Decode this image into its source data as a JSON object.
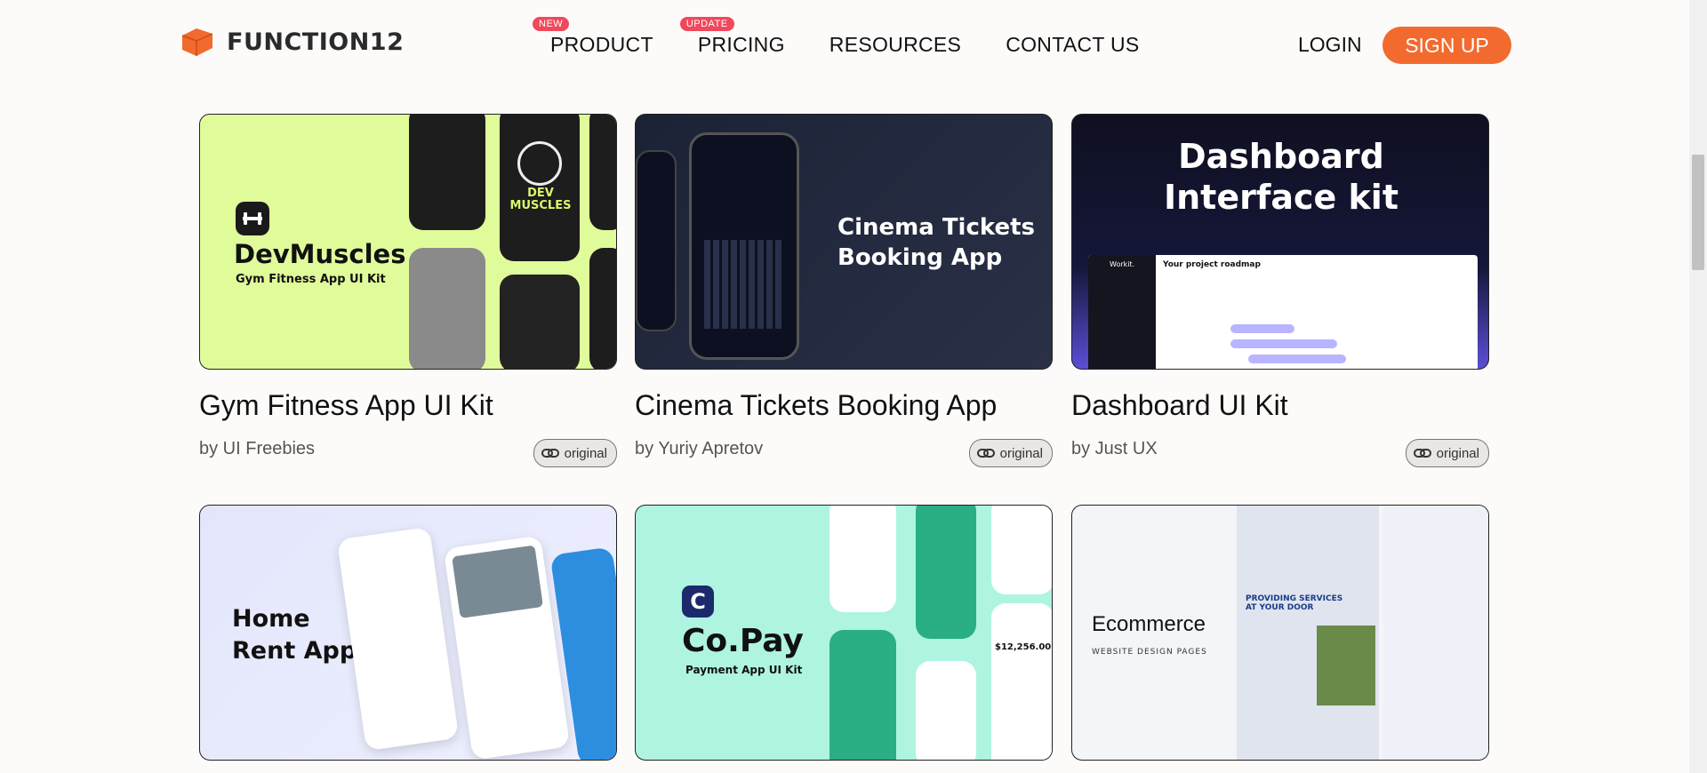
{
  "nav": {
    "logo_text": "FUNCTION12",
    "items": [
      {
        "label": "PRODUCT",
        "badge": "NEW"
      },
      {
        "label": "PRICING",
        "badge": "UPDATE"
      },
      {
        "label": "RESOURCES",
        "badge": ""
      },
      {
        "label": "CONTACT US",
        "badge": ""
      }
    ],
    "login": "LOGIN",
    "signup": "SIGN UP",
    "accent": "#f26a2e",
    "badge_color": "#f0485c"
  },
  "cards": [
    {
      "title": "Gym Fitness App UI Kit",
      "author": "by UI Freebies",
      "tag": "original",
      "thumb": {
        "heading": "DevMuscles",
        "sub": "Gym Fitness App UI Kit",
        "badge": "DEV MUSCLES"
      }
    },
    {
      "title": "Cinema Tickets Booking App",
      "author": "by Yuriy Apretov",
      "tag": "original",
      "thumb": {
        "heading": "Cinema Tickets Booking App"
      }
    },
    {
      "title": "Dashboard UI Kit",
      "author": "by Just UX",
      "tag": "original",
      "thumb": {
        "heading": "Dashboard Interface kit",
        "panel_title": "Your project roadmap",
        "brand": "Workit."
      }
    },
    {
      "title": "",
      "author": "",
      "tag": "",
      "thumb": {
        "heading": "Home Rent App"
      }
    },
    {
      "title": "",
      "author": "",
      "tag": "",
      "thumb": {
        "heading": "Co.Pay",
        "sub": "Payment App UI Kit",
        "amount": "$12,256.00"
      }
    },
    {
      "title": "",
      "author": "",
      "tag": "",
      "thumb": {
        "heading": "Ecommerce",
        "sub": "WEBSITE DESIGN PAGES",
        "banner": "PROVIDING SERVICES AT YOUR DOOR"
      }
    }
  ]
}
